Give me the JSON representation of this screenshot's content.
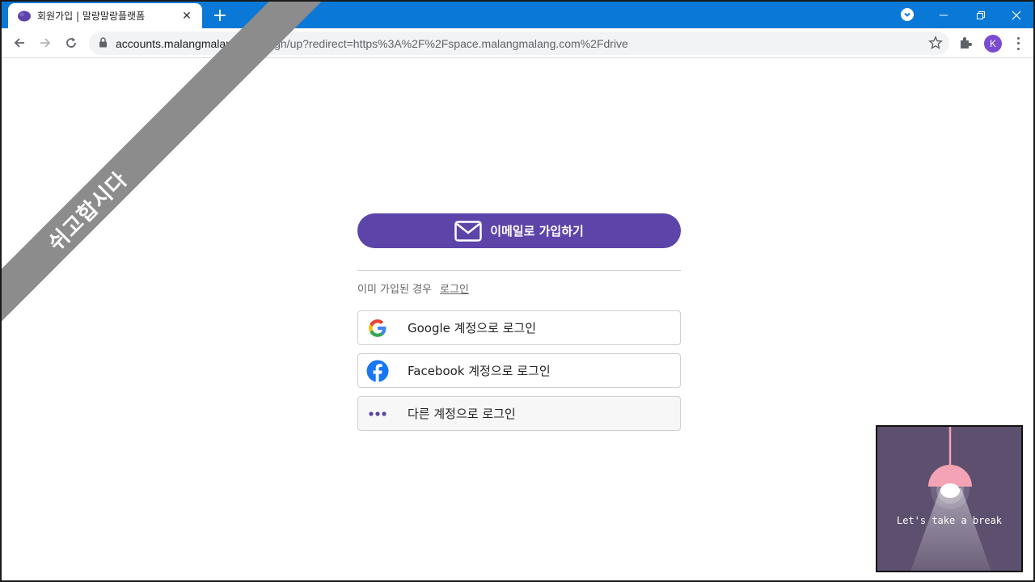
{
  "browser": {
    "tab_title": "회원가입 | 말랑말랑플랫폼",
    "tab_close": "✕",
    "new_tab": "+",
    "url_host": "accounts.malangmalang.com",
    "url_path": "/sign/up?redirect=https%3A%2F%2Fspace.malangmalang.com%2Fdrive",
    "profile_initial": "K",
    "accent": "#0a78d7"
  },
  "banner": {
    "text": "쉬고합시다",
    "color": "#8c8c8c"
  },
  "signup": {
    "email_button": "이메일로 가입하기",
    "already_text": "이미 가입된 경우",
    "login_link": "로그인",
    "brand_color": "#5c44a8",
    "social": [
      {
        "icon": "google-icon",
        "label": "Google 계정으로 로그인"
      },
      {
        "icon": "facebook-icon",
        "label": "Facebook 계정으로 로그인"
      },
      {
        "icon": "more-icon",
        "label": "다른 계정으로 로그인"
      }
    ]
  },
  "break_widget": {
    "text": "Let's take a break"
  }
}
